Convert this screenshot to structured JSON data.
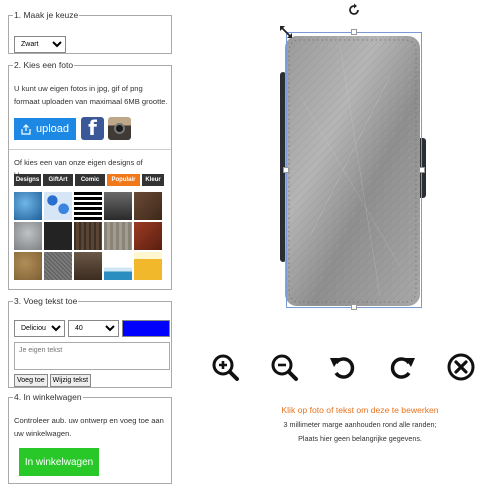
{
  "step1": {
    "legend": "1. Maak je keuze",
    "select_value": "Zwart"
  },
  "step2": {
    "legend": "2. Kies een foto",
    "intro": "U kunt uw eigen fotos in jpg, gif of png formaat uploaden van maximaal 6MB grootte.",
    "upload_label": "upload",
    "choose_text": "Of kies een van onze eigen designs of kleuren:",
    "tabs": [
      "Designs",
      "GiftArt",
      "Comic",
      "Populair",
      "Kleur"
    ],
    "active_tab": "Populair"
  },
  "step3": {
    "legend": "3. Voeg tekst toe",
    "font_value": "Delicious",
    "size_value": "40",
    "text_color": "#0000ff",
    "text_placeholder": "Je eigen tekst",
    "add_label": "Voeg toe",
    "edit_label": "Wijzig tekst"
  },
  "step4": {
    "legend": "4. In winkelwagen",
    "check_text": "Controleer aub. uw ontwerp en voeg toe aan uw winkelwagen.",
    "cart_label": "In winkelwagen"
  },
  "hints": {
    "line1": "Klik op foto of tekst om deze te bewerken",
    "line2": "3 millimeter marge aanhouden rond alle randen;",
    "line3": "Plaats hier geen belangrijke gegevens."
  },
  "colors": {
    "accent_orange": "#f07818",
    "upload_blue": "#1e88e5",
    "cart_green": "#28c828"
  }
}
